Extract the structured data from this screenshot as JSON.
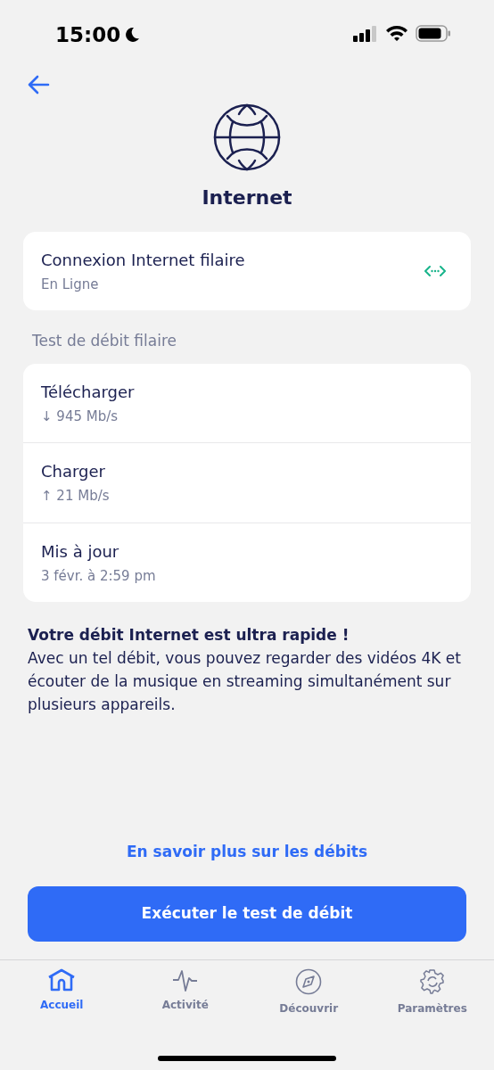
{
  "status_bar": {
    "time": "15:00"
  },
  "title": "Internet",
  "connection": {
    "name": "Connexion Internet filaire",
    "status": "En Ligne"
  },
  "section_header": "Test de débit filaire",
  "results": [
    {
      "label": "Télécharger",
      "value": "↓ 945 Mb/s"
    },
    {
      "label": "Charger",
      "value": "↑ 21 Mb/s"
    },
    {
      "label": "Mis à jour",
      "value": "3 févr. à 2:59 pm"
    }
  ],
  "message": {
    "headline": "Votre débit Internet est ultra rapide !",
    "body": "Avec un tel débit, vous pouvez regarder des vidéos 4K et écouter de la musique en streaming simultanément sur plusieurs appareils."
  },
  "learn_more_link": "En savoir plus sur les débits",
  "run_button": "Exécuter le test de débit",
  "tabs": [
    {
      "kind": "home",
      "label": "Accueil",
      "selected": true
    },
    {
      "kind": "activity",
      "label": "Activité",
      "selected": false
    },
    {
      "kind": "discover",
      "label": "Découvrir",
      "selected": false
    },
    {
      "kind": "settings",
      "label": "Paramètres",
      "selected": false
    }
  ]
}
